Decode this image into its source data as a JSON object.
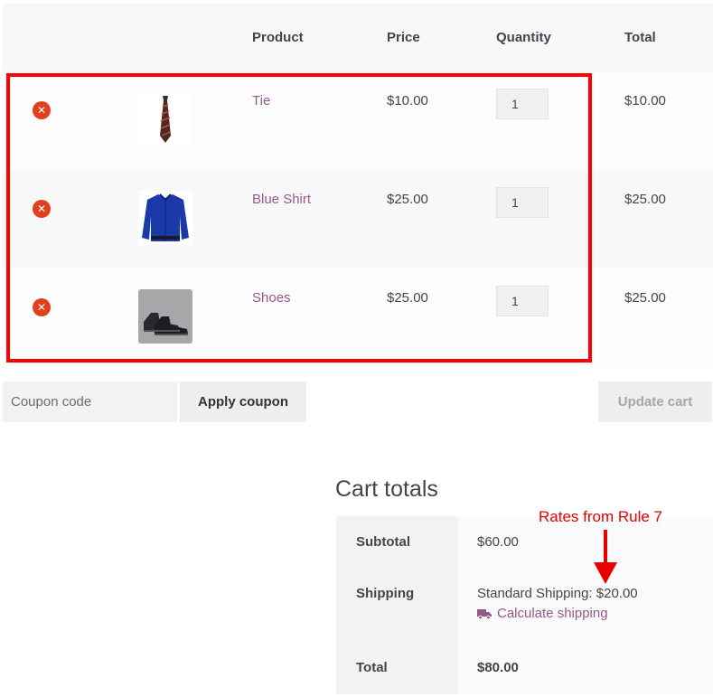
{
  "table": {
    "headers": {
      "product": "Product",
      "price": "Price",
      "quantity": "Quantity",
      "total": "Total"
    },
    "items": [
      {
        "name": "Tie",
        "price": "$10.00",
        "quantity": "1",
        "total": "$10.00",
        "image": "tie-image"
      },
      {
        "name": "Blue Shirt",
        "price": "$25.00",
        "quantity": "1",
        "total": "$25.00",
        "image": "shirt-image"
      },
      {
        "name": "Shoes",
        "price": "$25.00",
        "quantity": "1",
        "total": "$25.00",
        "image": "shoes-image"
      }
    ],
    "remove_icon": "remove-icon"
  },
  "actions": {
    "coupon_placeholder": "Coupon code",
    "apply_label": "Apply coupon",
    "update_label": "Update cart"
  },
  "totals": {
    "title": "Cart totals",
    "subtotal_label": "Subtotal",
    "subtotal_value": "$60.00",
    "shipping_label": "Shipping",
    "shipping_value": "Standard Shipping: $20.00",
    "calculate_label": "Calculate shipping",
    "total_label": "Total",
    "total_value": "$80.00"
  },
  "annotation": {
    "text": "Rates from Rule 7"
  },
  "colors": {
    "accent": "#96588a",
    "remove": "#e2401c",
    "highlight": "#ff0000",
    "annotation": "#e60000"
  }
}
